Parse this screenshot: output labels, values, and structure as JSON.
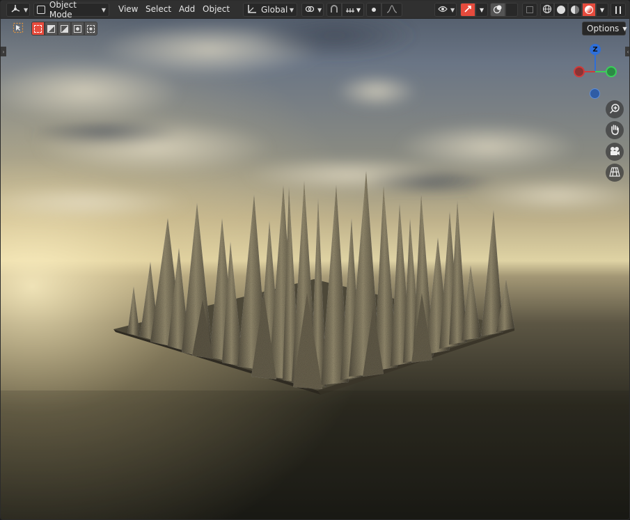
{
  "header": {
    "editor_type_icon": "view3d-icon",
    "mode_label": "Object Mode",
    "menus": [
      "View",
      "Select",
      "Add",
      "Object"
    ],
    "orientation_label": "Global",
    "pivot_icon": "pivot-icon",
    "snap_icon": "snap-magnet-icon",
    "snap_increment_icon": "snap-increment-icon",
    "proportional_icon": "proportional-edit-icon",
    "falloff_icon": "falloff-curve-icon",
    "visibility_icon": "eye-icon",
    "gizmo_icon": "gizmo-icon",
    "overlay_icon": "overlay-icon",
    "xray_icon": "xray-icon",
    "shading_modes": [
      "wireframe",
      "solid",
      "material-preview",
      "rendered"
    ],
    "active_shading": "rendered"
  },
  "tool_settings": {
    "active_tool_icon": "select-cursor-icon",
    "select_modes": [
      "new",
      "extend",
      "subtract",
      "invert",
      "intersect"
    ],
    "options_label": "Options"
  },
  "gizmo": {
    "z_label": "Z",
    "colors": {
      "x": "#d03b3b",
      "y": "#3bcf5a",
      "z": "#2f6fd8"
    }
  },
  "nav_buttons": [
    "zoom-icon",
    "pan-hand-icon",
    "camera-icon",
    "ortho-grid-icon"
  ],
  "scene": {
    "object": "spiky terrain mesh",
    "colors": {
      "sky_top": "#5d6f86",
      "horizon": "#e9d9a6",
      "ground": "#1c1c16",
      "mesh": "#8a7f63"
    }
  }
}
